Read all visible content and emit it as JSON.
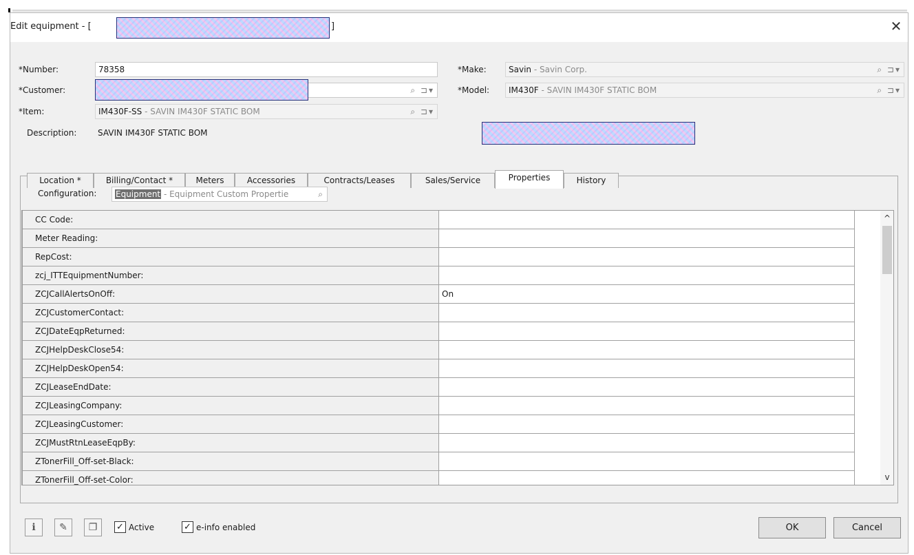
{
  "window": {
    "title": "Edit equipment - [",
    "title_close_bracket": "]",
    "close_glyph": "✕"
  },
  "fields": {
    "number": {
      "label": "*Number:",
      "value": "78358"
    },
    "customer": {
      "label": "*Customer:",
      "value": ""
    },
    "item": {
      "label": "*Item:",
      "code": "IM430F-SS",
      "desc": " - SAVIN IM430F STATIC BOM"
    },
    "description": {
      "label": "Description:",
      "value": "SAVIN IM430F STATIC BOM"
    },
    "make": {
      "label": "*Make:",
      "code": "Savin",
      "desc": " - Savin Corp."
    },
    "model": {
      "label": "*Model:",
      "code": "IM430F",
      "desc": " - SAVIN IM430F STATIC BOM"
    },
    "lookup_glyph": "⌕",
    "menu_glyph": "⊐▾"
  },
  "tabs": [
    {
      "label": "Location *"
    },
    {
      "label": "Billing/Contact *"
    },
    {
      "label": "Meters"
    },
    {
      "label": "Accessories"
    },
    {
      "label": "Contracts/Leases"
    },
    {
      "label": "Sales/Service"
    },
    {
      "label": "Properties"
    },
    {
      "label": "History"
    }
  ],
  "active_tab": "Properties",
  "configuration": {
    "label": "Configuration:",
    "code": "Equipment",
    "desc": " - Equipment Custom Propertie"
  },
  "properties": [
    {
      "name": "CC Code:",
      "value": ""
    },
    {
      "name": "Meter Reading:",
      "value": ""
    },
    {
      "name": "RepCost:",
      "value": ""
    },
    {
      "name": "zcj_ITTEquipmentNumber:",
      "value": ""
    },
    {
      "name": "ZCJCallAlertsOnOff:",
      "value": "On"
    },
    {
      "name": "ZCJCustomerContact:",
      "value": ""
    },
    {
      "name": "ZCJDateEqpReturned:",
      "value": ""
    },
    {
      "name": "ZCJHelpDeskClose54:",
      "value": ""
    },
    {
      "name": "ZCJHelpDeskOpen54:",
      "value": ""
    },
    {
      "name": "ZCJLeaseEndDate:",
      "value": ""
    },
    {
      "name": "ZCJLeasingCompany:",
      "value": ""
    },
    {
      "name": "ZCJLeasingCustomer:",
      "value": ""
    },
    {
      "name": "ZCJMustRtnLeaseEqpBy:",
      "value": ""
    },
    {
      "name": "ZTonerFill_Off-set-Black:",
      "value": ""
    },
    {
      "name": "ZTonerFill_Off-set-Color:",
      "value": ""
    }
  ],
  "scroll": {
    "up": "^",
    "down": "v"
  },
  "footer": {
    "info_glyph": "ℹ",
    "attach_glyph": "✎",
    "copy_glyph": "❐",
    "active_label": "Active",
    "active_checked": "✓",
    "einfo_label": "e-info enabled",
    "einfo_checked": "✓",
    "ok": "OK",
    "cancel": "Cancel"
  },
  "colors": {
    "selection": "#6e6e6e",
    "window": "#f0f0f0",
    "redaction_border": "#24307a"
  }
}
